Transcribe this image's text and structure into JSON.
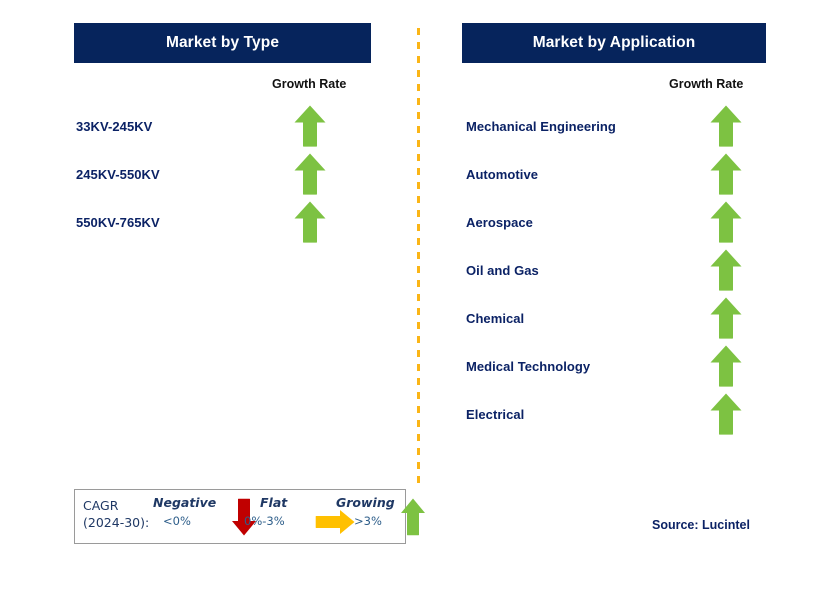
{
  "colors": {
    "navy": "#06245C",
    "label_navy": "#0B2265",
    "green": "#7DC242",
    "red": "#C00000",
    "orange": "#FFC000",
    "divider_amber": "#FBB516",
    "legend_text": "#1F3864",
    "legend_range": "#2E5E8A"
  },
  "columns": [
    {
      "id": "type",
      "header": "Market by Type",
      "growth_caption": "Growth Rate",
      "rows": [
        {
          "label": "33KV-245KV",
          "trend": "growing",
          "icon": "arrow-up-icon"
        },
        {
          "label": "245KV-550KV",
          "trend": "growing",
          "icon": "arrow-up-icon"
        },
        {
          "label": "550KV-765KV",
          "trend": "growing",
          "icon": "arrow-up-icon"
        }
      ]
    },
    {
      "id": "application",
      "header": "Market by Application",
      "growth_caption": "Growth Rate",
      "rows": [
        {
          "label": "Mechanical Engineering",
          "trend": "growing",
          "icon": "arrow-up-icon"
        },
        {
          "label": "Automotive",
          "trend": "growing",
          "icon": "arrow-up-icon"
        },
        {
          "label": "Aerospace",
          "trend": "growing",
          "icon": "arrow-up-icon"
        },
        {
          "label": "Oil and Gas",
          "trend": "growing",
          "icon": "arrow-up-icon"
        },
        {
          "label": "Chemical",
          "trend": "growing",
          "icon": "arrow-up-icon"
        },
        {
          "label": "Medical Technology",
          "trend": "growing",
          "icon": "arrow-up-icon"
        },
        {
          "label": "Electrical",
          "trend": "growing",
          "icon": "arrow-up-icon"
        }
      ]
    }
  ],
  "legend": {
    "title_line1": "CAGR",
    "title_line2": "(2024-30):",
    "items": [
      {
        "label": "Negative",
        "range": "<0%",
        "icon": "arrow-down-icon",
        "color": "#C00000"
      },
      {
        "label": "Flat",
        "range": "0%-3%",
        "icon": "arrow-right-icon",
        "color": "#FFC000"
      },
      {
        "label": "Growing",
        "range": ">3%",
        "icon": "arrow-up-icon",
        "color": "#7DC242"
      }
    ]
  },
  "source": "Source: Lucintel"
}
